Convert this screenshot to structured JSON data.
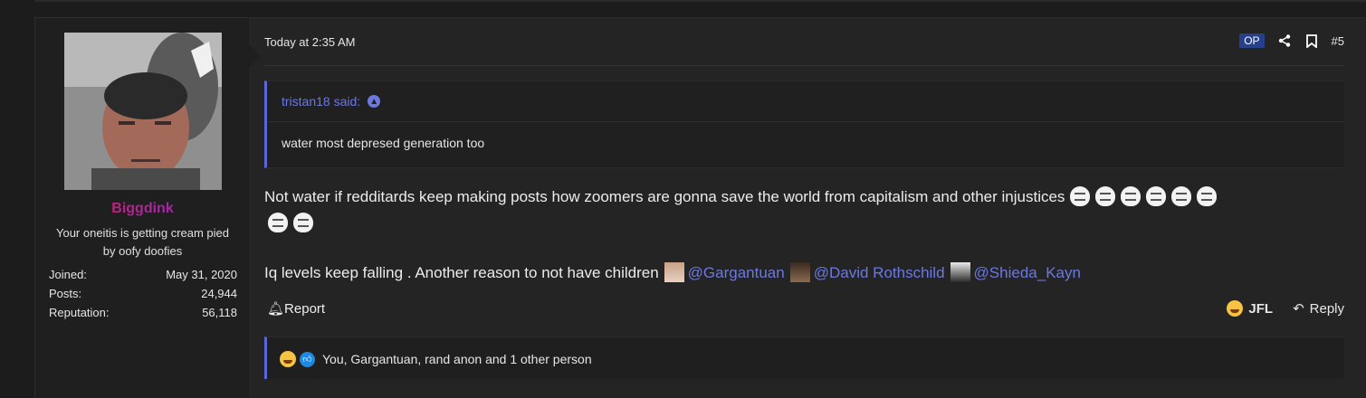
{
  "user": {
    "name": "Biggdink",
    "title": "Your oneitis is getting cream pied by oofy doofies",
    "stats": [
      {
        "label": "Joined:",
        "value": "May 31, 2020"
      },
      {
        "label": "Posts:",
        "value": "24,944"
      },
      {
        "label": "Reputation:",
        "value": "56,118"
      }
    ]
  },
  "post": {
    "date": "Today at 2:35 AM",
    "op_badge": "OP",
    "number": "#5",
    "quote": {
      "author": "tristan18 said:",
      "text": "water most depresed generation too"
    },
    "paragraph1": "Not water if redditards keep making posts how zoomers are gonna save the world from capitalism and other injustices",
    "paragraph2": "Iq levels keep falling . Another reason to not have children",
    "mentions": [
      "@Gargantuan",
      "@David Rothschild",
      "@Shieda_Kayn"
    ],
    "emoji_count": 8
  },
  "actions": {
    "report": "Report",
    "jfl": "JFL",
    "reply": "Reply"
  },
  "reactions": {
    "text": "You, Gargantuan, rand anon and 1 other person"
  },
  "icons": [
    "share-icon",
    "bookmark-icon",
    "bell-icon",
    "reply-arrow-icon",
    "laughing-emoji-icon",
    "thumbs-up-icon"
  ],
  "colors": {
    "accent": "#6b79e0",
    "op_badge": "#26408b",
    "username_gradient_start": "#d81b4d",
    "username_gradient_end": "#8a2be2"
  }
}
